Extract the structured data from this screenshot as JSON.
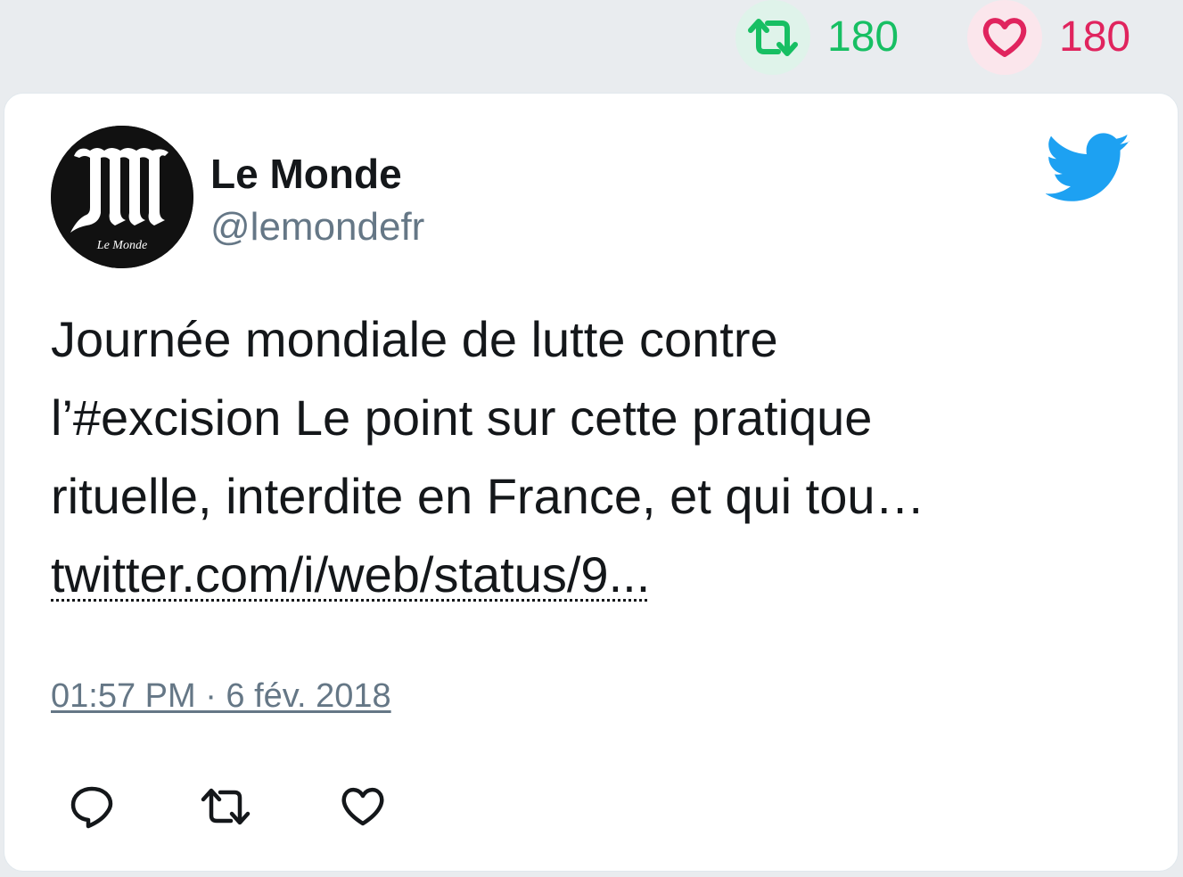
{
  "stats": {
    "retweet_count": "180",
    "like_count": "180",
    "retweet_color": "#17bf63",
    "like_color": "#e0245e"
  },
  "tweet": {
    "author_name": "Le Monde",
    "author_handle": "@lemondefr",
    "avatar_text": "Le Monde",
    "text_line_1": "Journée mondiale de lutte contre",
    "text_line_2": "l’#excision Le point sur cette pratique",
    "text_line_3": "rituelle, interdite en France, et qui tou…",
    "link_text": "twitter.com/i/web/status/9...",
    "timestamp": "01:57 PM · 6 fév. 2018"
  },
  "icons": {
    "retweet": "retweet-icon",
    "like": "heart-icon",
    "reply": "reply-icon",
    "brand": "twitter-bird-icon",
    "brand_color": "#1da1f2"
  }
}
